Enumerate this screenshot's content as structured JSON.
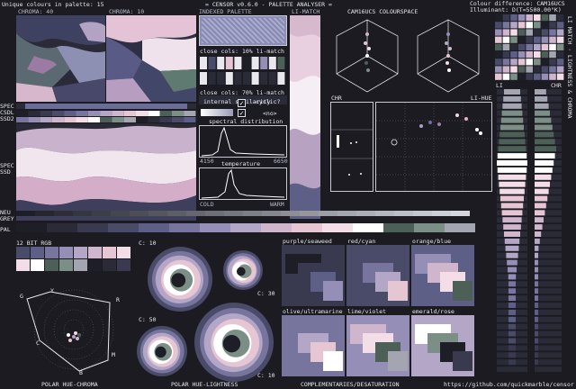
{
  "header": {
    "unique_colours": "Unique colours in palette: 15",
    "title": "= CENSOR v0.6.0 - PALETTE ANALYSER =",
    "colour_difference": "Colour difference: CAM16UCS",
    "illuminant": "Illuminant: D(T=5500.00°K)"
  },
  "labels": {
    "chroma40": "CHROMA: 40",
    "chroma10": "CHROMA: 10",
    "indexed_palette": "INDEXED PALETTE",
    "li_match": "LI-MATCH",
    "cam16ucs_space": "CAM16UCS COLOURSPACE",
    "close_cols_10": "close cols: 10% li-match",
    "close_cols_70": "close cols: 70% li-match",
    "internal_similarity": "internal similarity",
    "cyclic": "cyclic?",
    "no": "<no>",
    "spectral_distribution": "spectral distribution",
    "spec_min": "4150",
    "spec_max": "6650",
    "temperature": "temperature",
    "cold": "COLD",
    "warm": "WARM",
    "chr_left": "CHR",
    "li_hue": "LI-HUE",
    "li": "LI",
    "chr_right": "CHR",
    "spec": "SPEC",
    "csdl": "CSDL",
    "ssd2": "SSD2",
    "spec2": "SPEC",
    "ssd": "SSD",
    "neu": "NEU",
    "grey": "GREY",
    "pal": "PAL",
    "bit_rgb": "12 BIT RGB",
    "c10_a": "C: 10",
    "c30_a": "C: 30",
    "c50": "C: 50",
    "c10_b": "C: 10",
    "polar_hue_chroma": "POLAR HUE-CHROMA",
    "polar_hue_lightness": "POLAR HUE-LIGHTNESS",
    "complementaries": "COMPLEMENTARIES/DESATURATION",
    "url": "https://github.com/quickmarble/censor",
    "vertical_right": "LI MATCH · LIGHTNESS & CHROMA",
    "pairs": [
      "purple/seaweed",
      "red/cyan",
      "orange/blue",
      "olive/ultramarine",
      "lime/violet",
      "emerald/rose"
    ],
    "hue_letters": [
      "G",
      "Y",
      "R",
      "C",
      "M",
      "B"
    ]
  },
  "palette": [
    "#1e1e26",
    "#2b2b38",
    "#393a4f",
    "#4a4b68",
    "#5e5f86",
    "#77759e",
    "#958eb6",
    "#b3a6c6",
    "#d0b6cc",
    "#e7c6d4",
    "#f3dde6",
    "#ffffff",
    "#4d6058",
    "#7c8f86",
    "#a3a6b0"
  ],
  "colors": {
    "bg": "#1b1b21",
    "frame": "#c9c9d4",
    "accent": "#e8b3c9"
  }
}
